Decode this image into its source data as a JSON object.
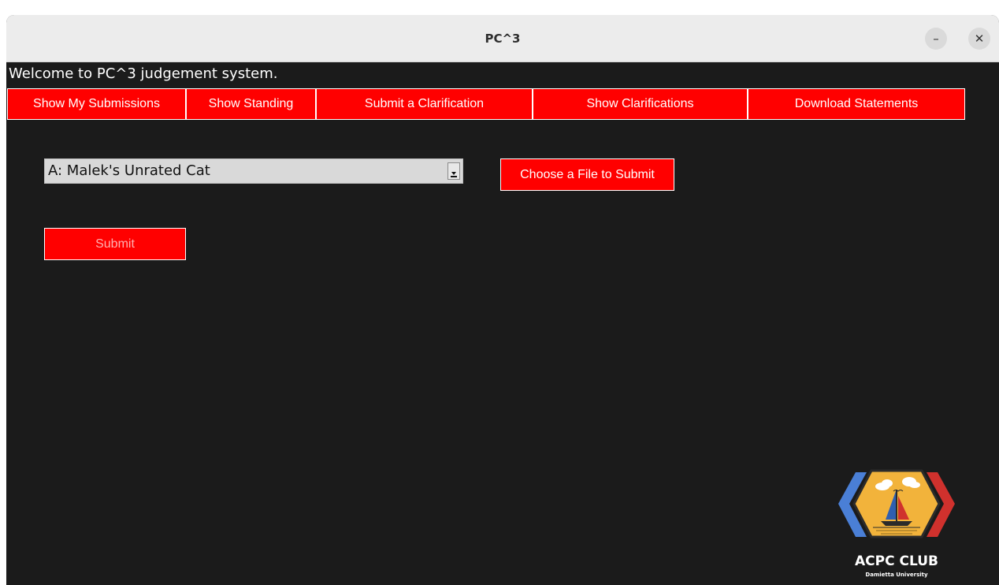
{
  "window": {
    "title": "PC^3",
    "minimize_label": "–",
    "close_label": "✕"
  },
  "welcome_text": "Welcome to PC^3 judgement system.",
  "nav": {
    "items": [
      {
        "label": "Show My Submissions"
      },
      {
        "label": "Show Standing"
      },
      {
        "label": "Submit a Clarification"
      },
      {
        "label": "Show Clarifications"
      },
      {
        "label": "Download Statements"
      }
    ]
  },
  "problem_select": {
    "selected": "A: Malek's Unrated Cat"
  },
  "choose_file_button": "Choose a File to Submit",
  "submit_button": "Submit",
  "logo": {
    "title": "ACPC CLUB",
    "subtitle": "Damietta University"
  },
  "colors": {
    "accent": "#ff0000",
    "background": "#1b1b1b",
    "titlebar": "#ececec"
  }
}
